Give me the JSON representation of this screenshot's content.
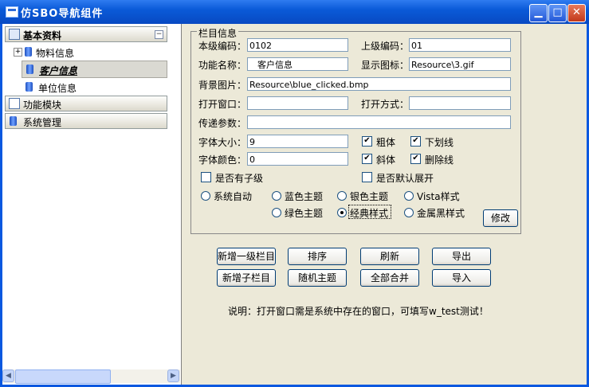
{
  "window": {
    "title": "仿SBO导航组件"
  },
  "titlebar": {
    "min_icon": "minimize-icon",
    "max_icon": "maximize-icon",
    "close_icon": "close-icon"
  },
  "sidebar": {
    "groups": [
      {
        "label": "基本资料",
        "expanded": true
      },
      {
        "label": "功能模块",
        "expanded": false
      },
      {
        "label": "系统管理",
        "expanded": false
      }
    ],
    "items": [
      {
        "label": "物料信息",
        "expandable": true
      },
      {
        "label": "客户信息",
        "selected": true
      },
      {
        "label": "单位信息"
      }
    ]
  },
  "form": {
    "legend": "栏目信息",
    "fields": {
      "level_code_label": "本级编码：",
      "level_code": "0102",
      "parent_code_label": "上级编码：",
      "parent_code": "01",
      "func_name_label": "功能名称：",
      "func_name": "客户信息",
      "icon_label": "显示图标：",
      "icon": "Resource\\3.gif",
      "bg_label": "背景图片：",
      "bg": "Resource\\blue_clicked.bmp",
      "open_window_label": "打开窗口：",
      "open_window": "",
      "open_mode_label": "打开方式：",
      "open_mode": "",
      "params_label": "传递参数：",
      "params": "",
      "font_size_label": "字体大小：",
      "font_size": "9",
      "font_color_label": "字体颜色：",
      "font_color": "0"
    },
    "checks": {
      "bold": "粗体",
      "underline": "下划线",
      "italic": "斜体",
      "strike": "删除线",
      "has_children": "是否有子级",
      "default_expand": "是否默认展开"
    },
    "themes": {
      "auto": "系统自动",
      "blue": "蓝色主题",
      "silver": "银色主题",
      "vista": "Vista样式",
      "green": "绿色主题",
      "classic": "经典样式",
      "metal": "金属黑样式"
    },
    "modify_button": "修改"
  },
  "actions": {
    "add_top": "新增一级栏目",
    "sort": "排序",
    "refresh": "刷新",
    "export": "导出",
    "add_child": "新增子栏目",
    "random_theme": "随机主题",
    "merge_all": "全部合并",
    "import": "导入"
  },
  "note": "说明：打开窗口需是系统中存在的窗口，可填写w_test测试！"
}
